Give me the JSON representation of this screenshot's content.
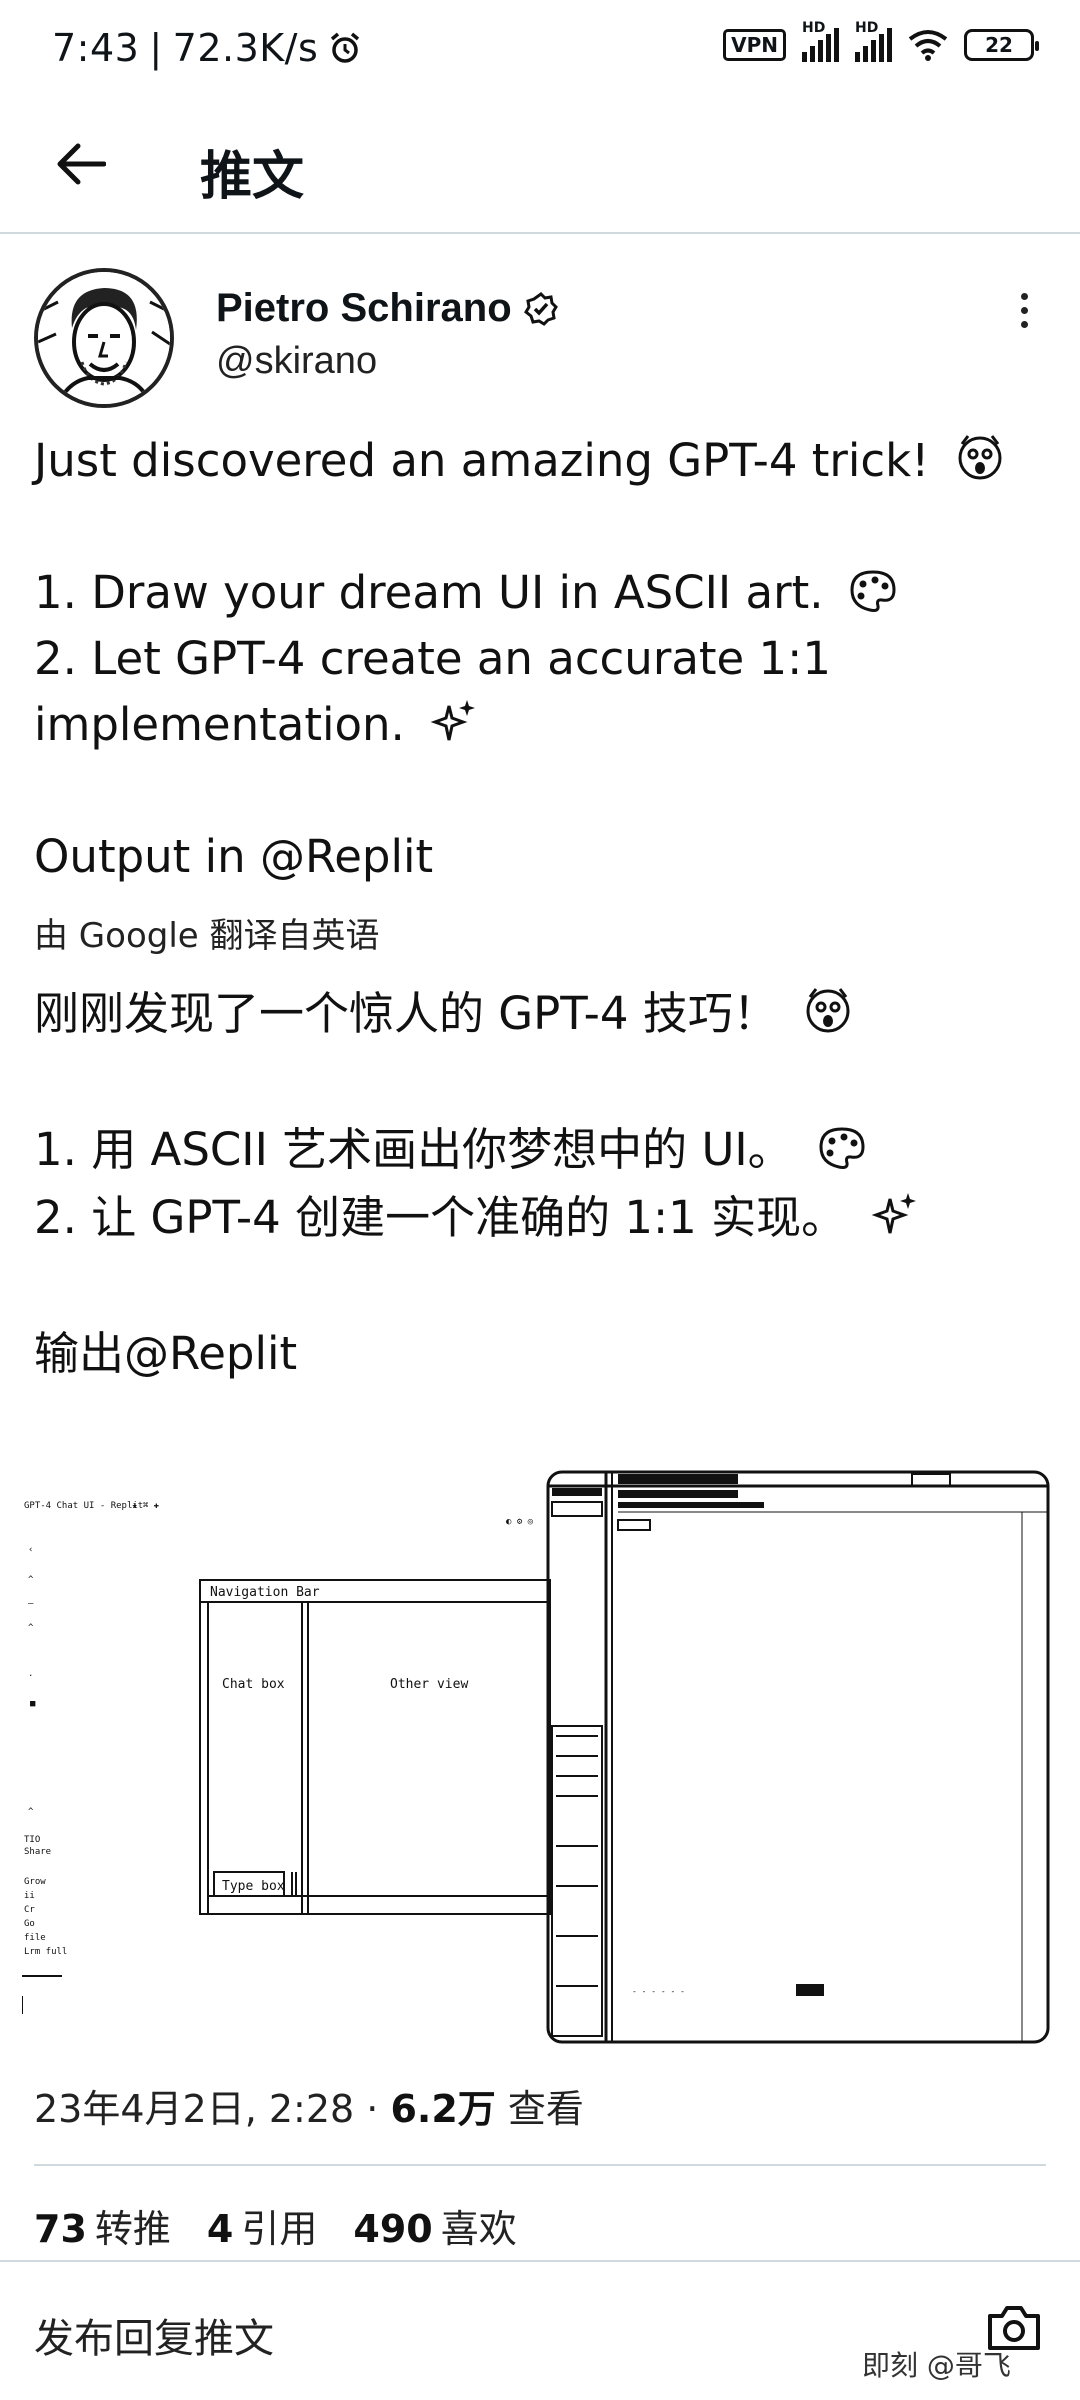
{
  "status_bar": {
    "time": "7:43",
    "net_speed": "72.3K/s",
    "vpn": "VPN",
    "hd1": "HD",
    "hd2": "HD",
    "battery": "22"
  },
  "header": {
    "title": "推文"
  },
  "author": {
    "name": "Pietro Schirano",
    "handle": "@skirano"
  },
  "tweet": {
    "line1": "Just discovered an amazing GPT-4 trick!",
    "line2": "1. Draw your dream UI in ASCII art.",
    "line3": "2. Let GPT-4 create an accurate 1:1",
    "line4": "implementation.",
    "line5": "Output in @Replit"
  },
  "translation": {
    "translated_by": "由 Google 翻译自英语",
    "line1": "刚刚发现了一个惊人的 GPT-4 技巧！",
    "line2": "1. 用 ASCII 艺术画出你梦想中的 UI。",
    "line3": "2. 让 GPT-4 创建一个准确的 1:1 实现。",
    "line4": "输出@Replit"
  },
  "media": {
    "doc_title": "GPT-4 Chat UI - Replit",
    "nav_bar_label": "Navigation Bar",
    "chat_box_label": "Chat box",
    "other_view_label": "Other view",
    "type_box_label": "Type box"
  },
  "meta": {
    "date": "23年4月2日, 2:28 · ",
    "views_count": "6.2万",
    "views_label": " 查看"
  },
  "stats": {
    "retweets_count": "73",
    "retweets_label": "转推",
    "quotes_count": "4",
    "quotes_label": "引用",
    "likes_count": "490",
    "likes_label": "喜欢"
  },
  "reply": {
    "placeholder": "发布回复推文"
  },
  "watermark": "即刻 @哥飞",
  "icons": {
    "back": "arrow-left-icon",
    "verified": "verified-badge-icon",
    "more": "more-vertical-icon",
    "camera": "camera-icon",
    "alarm": "alarm-icon",
    "wifi": "wifi-icon",
    "emoji_scream": "scream-emoji-icon",
    "emoji_palette": "palette-emoji-icon",
    "emoji_sparkles": "sparkles-emoji-icon"
  }
}
